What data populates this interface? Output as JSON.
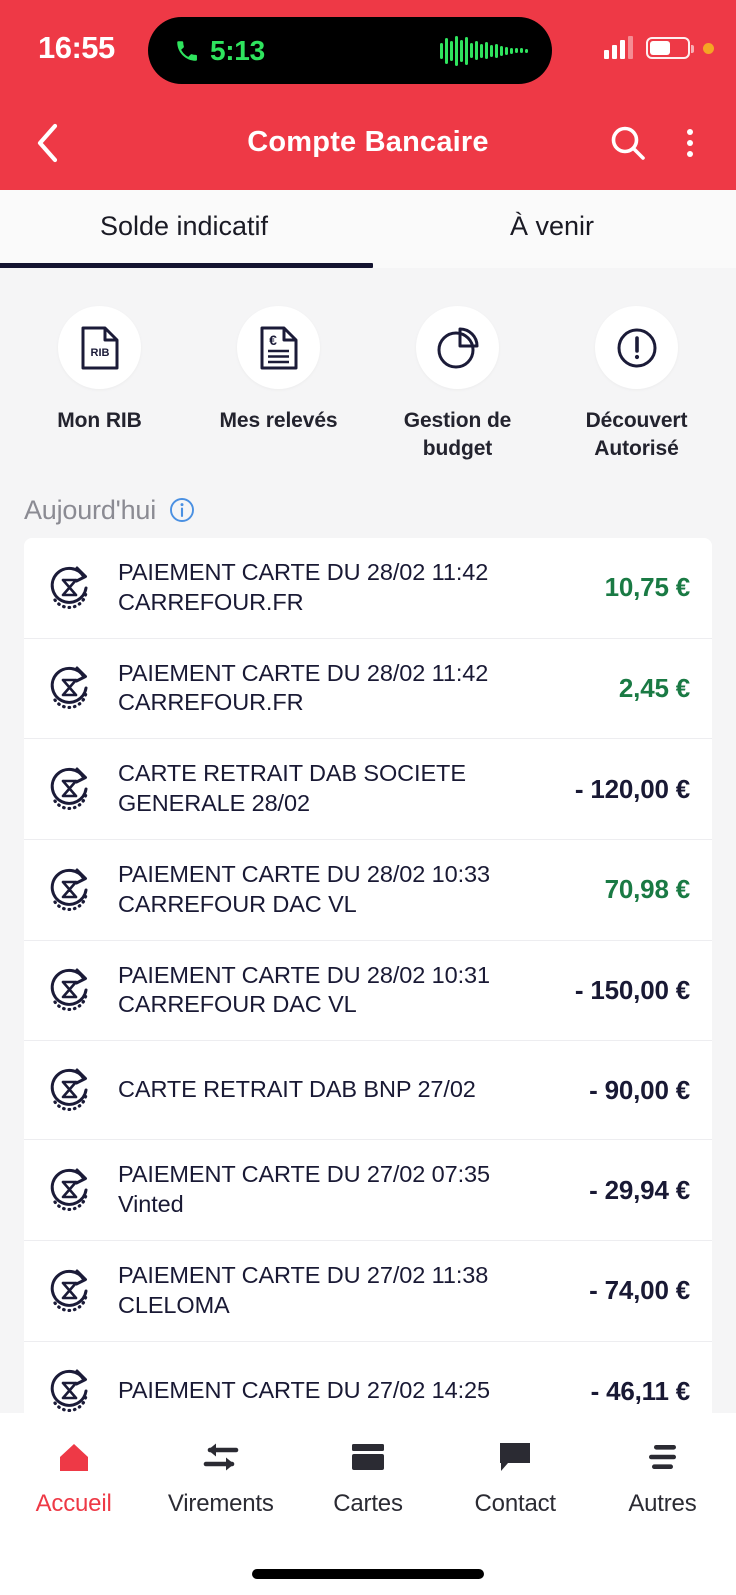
{
  "status_bar": {
    "time": "16:55",
    "call_pill": {
      "icon": "phone-call-icon",
      "duration": "5:13",
      "waveform_icon": "audio-waveform-icon"
    },
    "signal_icon": "cellular-signal-icon",
    "signal_bars_filled": 3,
    "signal_bars_total": 4,
    "battery_icon": "battery-icon",
    "battery_percent": 55,
    "privacy_indicator_icon": "orange-privacy-dot-icon",
    "privacy_color": "#f5a524"
  },
  "header": {
    "back_icon": "chevron-left-icon",
    "title": "Compte Bancaire",
    "search_icon": "search-icon",
    "menu_icon": "kebab-menu-icon",
    "background_color": "#ee3946"
  },
  "tabs": [
    {
      "label": "Solde indicatif",
      "active": true
    },
    {
      "label": "À venir",
      "active": false
    }
  ],
  "quick_actions": [
    {
      "icon": "rib-document-icon",
      "label": "Mon RIB"
    },
    {
      "icon": "euro-statement-document-icon",
      "label": "Mes relevés"
    },
    {
      "icon": "pie-chart-icon",
      "label": "Gestion\nde budget"
    },
    {
      "icon": "exclamation-circle-icon",
      "label": "Découvert\nAutorisé"
    }
  ],
  "section": {
    "title": "Aujourd'hui",
    "info_icon": "info-circle-icon"
  },
  "transactions": [
    {
      "icon": "pending-hourglass-icon",
      "line1": "PAIEMENT CARTE DU 28/02 11:42",
      "line2": "CARREFOUR.FR",
      "amount": "10,75 €",
      "credit": true
    },
    {
      "icon": "pending-hourglass-icon",
      "line1": "PAIEMENT CARTE DU 28/02 11:42",
      "line2": "CARREFOUR.FR",
      "amount": "2,45 €",
      "credit": true
    },
    {
      "icon": "pending-hourglass-icon",
      "line1": "CARTE RETRAIT DAB SOCIETE",
      "line2": "GENERALE 28/02",
      "amount": "- 120,00 €",
      "credit": false
    },
    {
      "icon": "pending-hourglass-icon",
      "line1": "PAIEMENT CARTE DU 28/02 10:33",
      "line2": "CARREFOUR DAC VL",
      "amount": "70,98 €",
      "credit": true
    },
    {
      "icon": "pending-hourglass-icon",
      "line1": "PAIEMENT CARTE DU 28/02 10:31",
      "line2": "CARREFOUR DAC VL",
      "amount": "- 150,00 €",
      "credit": false
    },
    {
      "icon": "pending-hourglass-icon",
      "line1": "CARTE RETRAIT DAB  BNP 27/02",
      "line2": "",
      "amount": "- 90,00 €",
      "credit": false
    },
    {
      "icon": "pending-hourglass-icon",
      "line1": "PAIEMENT CARTE DU 27/02 07:35",
      "line2": "Vinted",
      "amount": "- 29,94 €",
      "credit": false
    },
    {
      "icon": "pending-hourglass-icon",
      "line1": "PAIEMENT CARTE DU 27/02 11:38",
      "line2": "CLELOMA",
      "amount": "- 74,00 €",
      "credit": false
    },
    {
      "icon": "pending-hourglass-icon",
      "line1": "PAIEMENT CARTE DU 27/02 14:25",
      "line2": "",
      "amount": "- 46,11 €",
      "credit": false
    }
  ],
  "bottom_nav": {
    "active_color": "#ee3946",
    "items": [
      {
        "icon": "home-icon",
        "label": "Accueil",
        "active": true
      },
      {
        "icon": "transfer-arrows-icon",
        "label": "Virements",
        "active": false
      },
      {
        "icon": "credit-card-icon",
        "label": "Cartes",
        "active": false
      },
      {
        "icon": "chat-bubble-icon",
        "label": "Contact",
        "active": false
      },
      {
        "icon": "more-lines-icon",
        "label": "Autres",
        "active": false
      }
    ],
    "home_indicator_icon": "home-indicator-bar"
  }
}
